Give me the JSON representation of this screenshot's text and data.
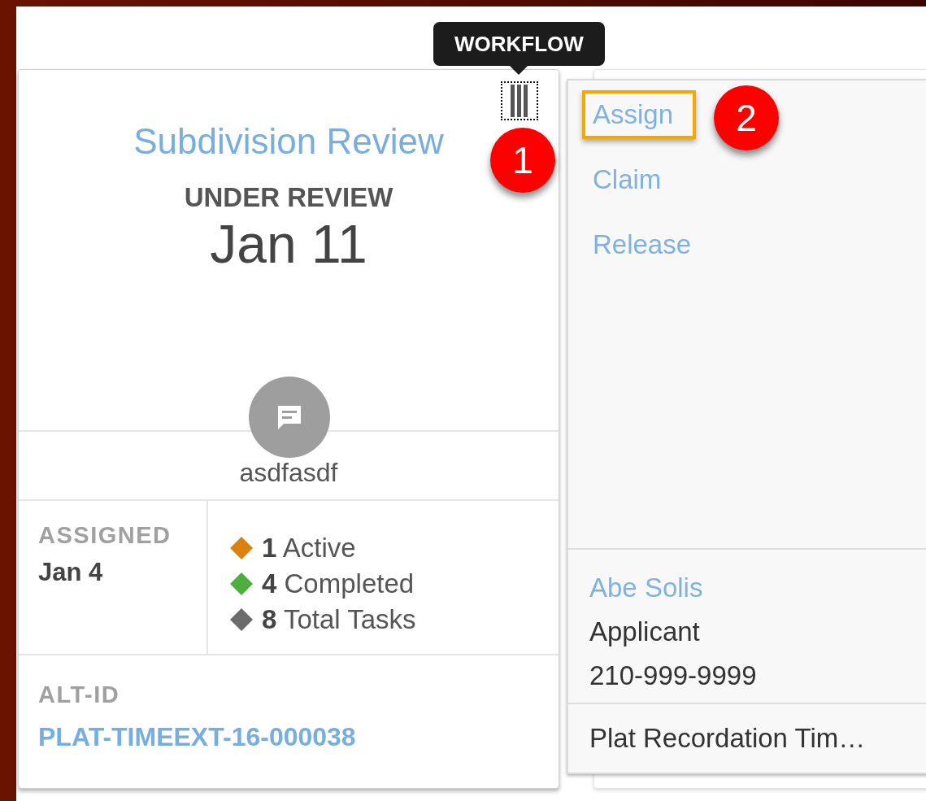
{
  "tooltip": {
    "text": "WORKFLOW"
  },
  "annotations": [
    {
      "number": "1"
    },
    {
      "number": "2"
    }
  ],
  "card": {
    "title": "Subdivision Review",
    "status": "UNDER REVIEW",
    "date": "Jan 11",
    "note": "asdfasdf",
    "assigned": {
      "label": "ASSIGNED",
      "date": "Jan 4"
    },
    "task_counts": [
      {
        "count": "1",
        "label": "Active",
        "color": "#d9820f"
      },
      {
        "count": "4",
        "label": "Completed",
        "color": "#4cae3c"
      },
      {
        "count": "8",
        "label": "Total Tasks",
        "color": "#6b6b6b"
      }
    ],
    "alt_id": {
      "label": "ALT-ID",
      "value": "PLAT-TIMEEXT-16-000038"
    }
  },
  "workflow_menu": {
    "actions": [
      {
        "label": "Assign",
        "highlighted": true
      },
      {
        "label": "Claim",
        "highlighted": false
      },
      {
        "label": "Release",
        "highlighted": false
      }
    ],
    "contact": {
      "name": "Abe Solis",
      "role": "Applicant",
      "phone": "210-999-9999"
    },
    "footer": "Plat Recordation Tim…"
  }
}
